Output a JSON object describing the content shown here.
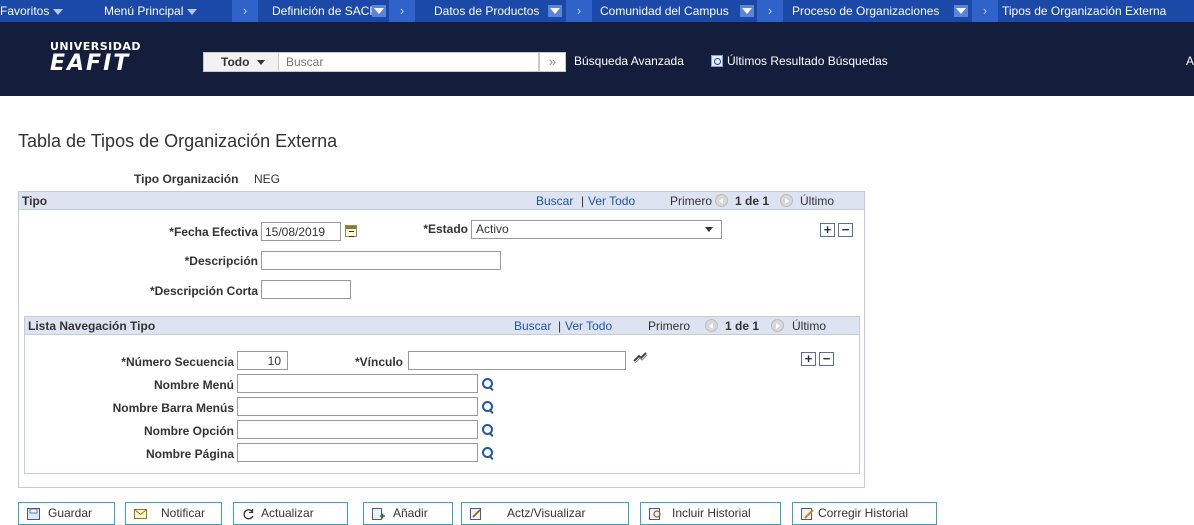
{
  "nav": {
    "favorites": "Favoritos",
    "main_menu": "Menú Principal",
    "breadcrumbs": [
      "Definición de SACR",
      "Datos de Productos",
      "Comunidad del Campus",
      "Proceso de Organizaciones",
      "Tipos de Organización Externa"
    ]
  },
  "header": {
    "logo_line1": "UNIVERSIDAD",
    "logo_line2": "EAFIT",
    "search_category": "Todo",
    "search_placeholder": "Buscar",
    "advanced_search": "Búsqueda Avanzada",
    "last_results": "Últimos Resultado Búsquedas",
    "edge_text": "A"
  },
  "page": {
    "title": "Tabla de Tipos de Organización Externa",
    "tipo_org_label": "Tipo Organización",
    "tipo_org_value": "NEG"
  },
  "tipo": {
    "title": "Tipo",
    "find": "Buscar",
    "sep": "|",
    "view_all": "Ver Todo",
    "first": "Primero",
    "count": "1 de 1",
    "last": "Último",
    "effdt_label": "*Fecha Efectiva",
    "effdt_value": "15/08/2019",
    "status_label": "*Estado",
    "status_value": "Activo",
    "descr_label": "*Descripción",
    "descr_value": "",
    "short_descr_label": "*Descripción Corta",
    "short_descr_value": ""
  },
  "lista": {
    "title": "Lista Navegación Tipo",
    "find": "Buscar",
    "sep": "|",
    "view_all": "Ver Todo",
    "first": "Primero",
    "count": "1 de 1",
    "last": "Último",
    "seq_label": "*Número Secuencia",
    "seq_value": "10",
    "link_label": "*Vínculo",
    "link_value": "",
    "menu_label": "Nombre Menú",
    "menu_value": "",
    "bar_label": "Nombre Barra Menús",
    "bar_value": "",
    "option_label": "Nombre Opción",
    "option_value": "",
    "page_label": "Nombre Página",
    "page_value": ""
  },
  "toolbar": {
    "save": "Guardar",
    "notify": "Notificar",
    "refresh": "Actualizar",
    "add": "Añadir",
    "update": "Actz/Visualizar",
    "include_history": "Incluir Historial",
    "correct_history": "Corregir Historial"
  },
  "colors": {
    "nav_bg": "#1a49a8",
    "header_bg": "#141e3c",
    "section_header": "#dde3f0",
    "link": "#2155a8",
    "button_border": "#36a6c4"
  }
}
